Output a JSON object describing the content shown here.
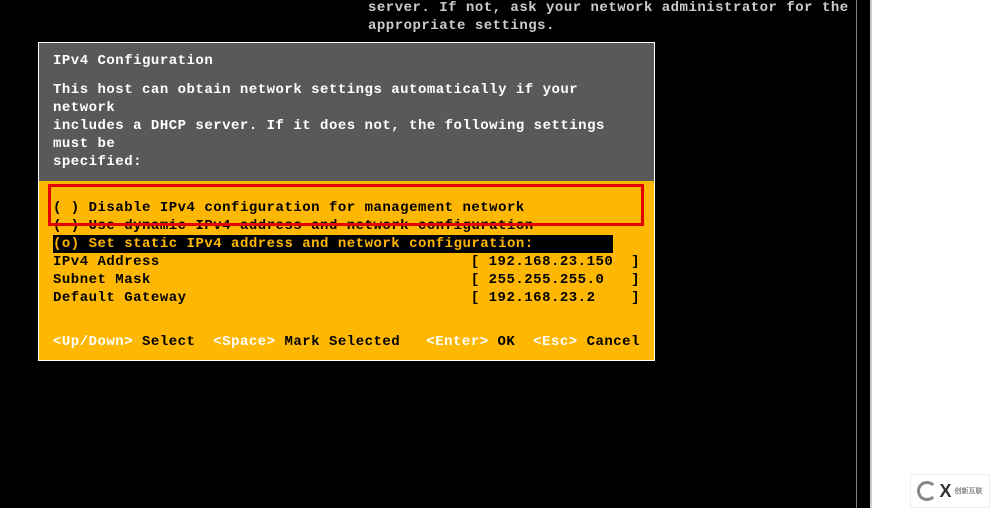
{
  "background": {
    "line1": "server. If not, ask your network administrator for the",
    "line2": "appropriate settings."
  },
  "dialog": {
    "title": "IPv4 Configuration",
    "description": "This host can obtain network settings automatically if your network\nincludes a DHCP server. If it does not, the following settings must be\nspecified:",
    "options": [
      {
        "mark": "( )",
        "label": "Disable IPv4 configuration for management network"
      },
      {
        "mark": "( )",
        "label": "Use dynamic IPv4 address and network configuration"
      },
      {
        "mark": "(o)",
        "label": "Set static IPv4 address and network configuration:"
      }
    ],
    "fields": [
      {
        "label": "IPv4 Address",
        "value": "192.168.23.150"
      },
      {
        "label": "Subnet Mask",
        "value": "255.255.255.0"
      },
      {
        "label": "Default Gateway",
        "value": "192.168.23.2"
      }
    ],
    "footer": {
      "updown_key": "<Up/Down>",
      "updown_label": "Select",
      "space_key": "<Space>",
      "space_label": "Mark Selected",
      "enter_key": "<Enter>",
      "enter_label": "OK",
      "esc_key": "<Esc>",
      "esc_label": "Cancel"
    }
  },
  "logo": {
    "text": "创新互联"
  }
}
